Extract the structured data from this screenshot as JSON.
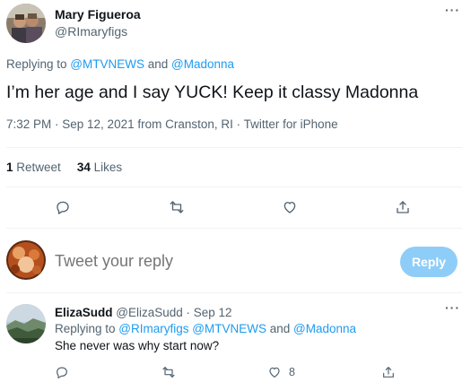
{
  "main_tweet": {
    "author_name": "Mary Figueroa",
    "author_handle": "@RImaryfigs",
    "replying_prefix": "Replying to ",
    "replying_to_1": "@MTVNEWS",
    "replying_and": " and ",
    "replying_to_2": "@Madonna",
    "text": "I’m her age and I say YUCK! Keep it classy Madonna",
    "meta": "7:32 PM · Sep 12, 2021 from Cranston, RI · Twitter for iPhone",
    "retweet_count": "1",
    "retweet_label": "Retweet",
    "like_count": "34",
    "like_label": "Likes",
    "more_label": "···"
  },
  "compose": {
    "placeholder": "Tweet your reply",
    "reply_button": "Reply"
  },
  "reply_tweet": {
    "author_name": "ElizaSudd",
    "author_handle": "@ElizaSudd",
    "date": " · Sep 12",
    "replying_prefix": "Replying to ",
    "replying_to_1": "@RImaryfigs",
    "replying_to_2": " @MTVNEWS",
    "replying_and": " and ",
    "replying_to_3": "@Madonna",
    "text": "She never was why start now?",
    "like_count": "8",
    "more_label": "···"
  },
  "icons": {
    "reply": "comment-icon",
    "retweet": "retweet-icon",
    "like": "heart-icon",
    "share": "share-icon"
  },
  "colors": {
    "accent": "#1d9bf0",
    "secondary_text": "#536471",
    "reply_button_disabled": "#8ecdf8",
    "divider": "#eff3f4"
  }
}
